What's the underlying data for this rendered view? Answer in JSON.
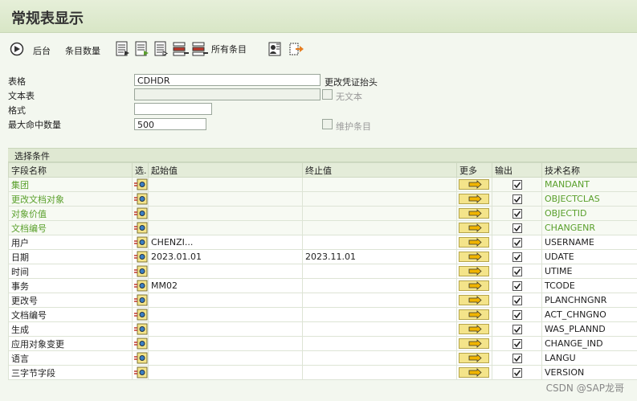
{
  "title": "常规表显示",
  "toolbar": {
    "background_label": "后台",
    "entry_count_label": "条目数量",
    "all_entries_label": "所有条目"
  },
  "form": {
    "table_label": "表格",
    "table_value": "CDHDR",
    "table_desc": "更改凭证抬头",
    "text_table_label": "文本表",
    "text_table_value": "",
    "no_text_label": "无文本",
    "format_label": "格式",
    "format_value": "",
    "max_hits_label": "最大命中数量",
    "max_hits_value": "500",
    "maintain_entries_label": "维护条目"
  },
  "section_title": "选择条件",
  "columns": {
    "field_name": "字段名称",
    "sel": "选.",
    "from": "起始值",
    "to": "终止值",
    "more": "更多",
    "output": "输出",
    "tech_name": "技术名称"
  },
  "rows": [
    {
      "field": "集团",
      "from": "",
      "to": "",
      "tech": "MANDANT",
      "key": true
    },
    {
      "field": "更改文档对象",
      "from": "",
      "to": "",
      "tech": "OBJECTCLAS",
      "key": true
    },
    {
      "field": "对象价值",
      "from": "",
      "to": "",
      "tech": "OBJECTID",
      "key": true
    },
    {
      "field": "文档编号",
      "from": "",
      "to": "",
      "tech": "CHANGENR",
      "key": true
    },
    {
      "field": "用户",
      "from": "CHENZI...",
      "to": "",
      "tech": "USERNAME",
      "key": false
    },
    {
      "field": "日期",
      "from": "2023.01.01",
      "to": "2023.11.01",
      "tech": "UDATE",
      "key": false
    },
    {
      "field": "时间",
      "from": "",
      "to": "",
      "tech": "UTIME",
      "key": false
    },
    {
      "field": "事务",
      "from": "MM02",
      "to": "",
      "tech": "TCODE",
      "key": false
    },
    {
      "field": "更改号",
      "from": "",
      "to": "",
      "tech": "PLANCHNGNR",
      "key": false
    },
    {
      "field": "文档编号",
      "from": "",
      "to": "",
      "tech": "ACT_CHNGNO",
      "key": false
    },
    {
      "field": "生成",
      "from": "",
      "to": "",
      "tech": "WAS_PLANND",
      "key": false
    },
    {
      "field": "应用对象变更",
      "from": "",
      "to": "",
      "tech": "CHANGE_IND",
      "key": false
    },
    {
      "field": "语言",
      "from": "",
      "to": "",
      "tech": "LANGU",
      "key": false
    },
    {
      "field": "三字节字段",
      "from": "",
      "to": "",
      "tech": "VERSION",
      "key": false
    }
  ],
  "watermark": "CSDN @SAP龙哥",
  "colors": {
    "key_field": "#5aa02c",
    "header_bg": "#e4ecd9",
    "more_button": "#f4e48a"
  }
}
